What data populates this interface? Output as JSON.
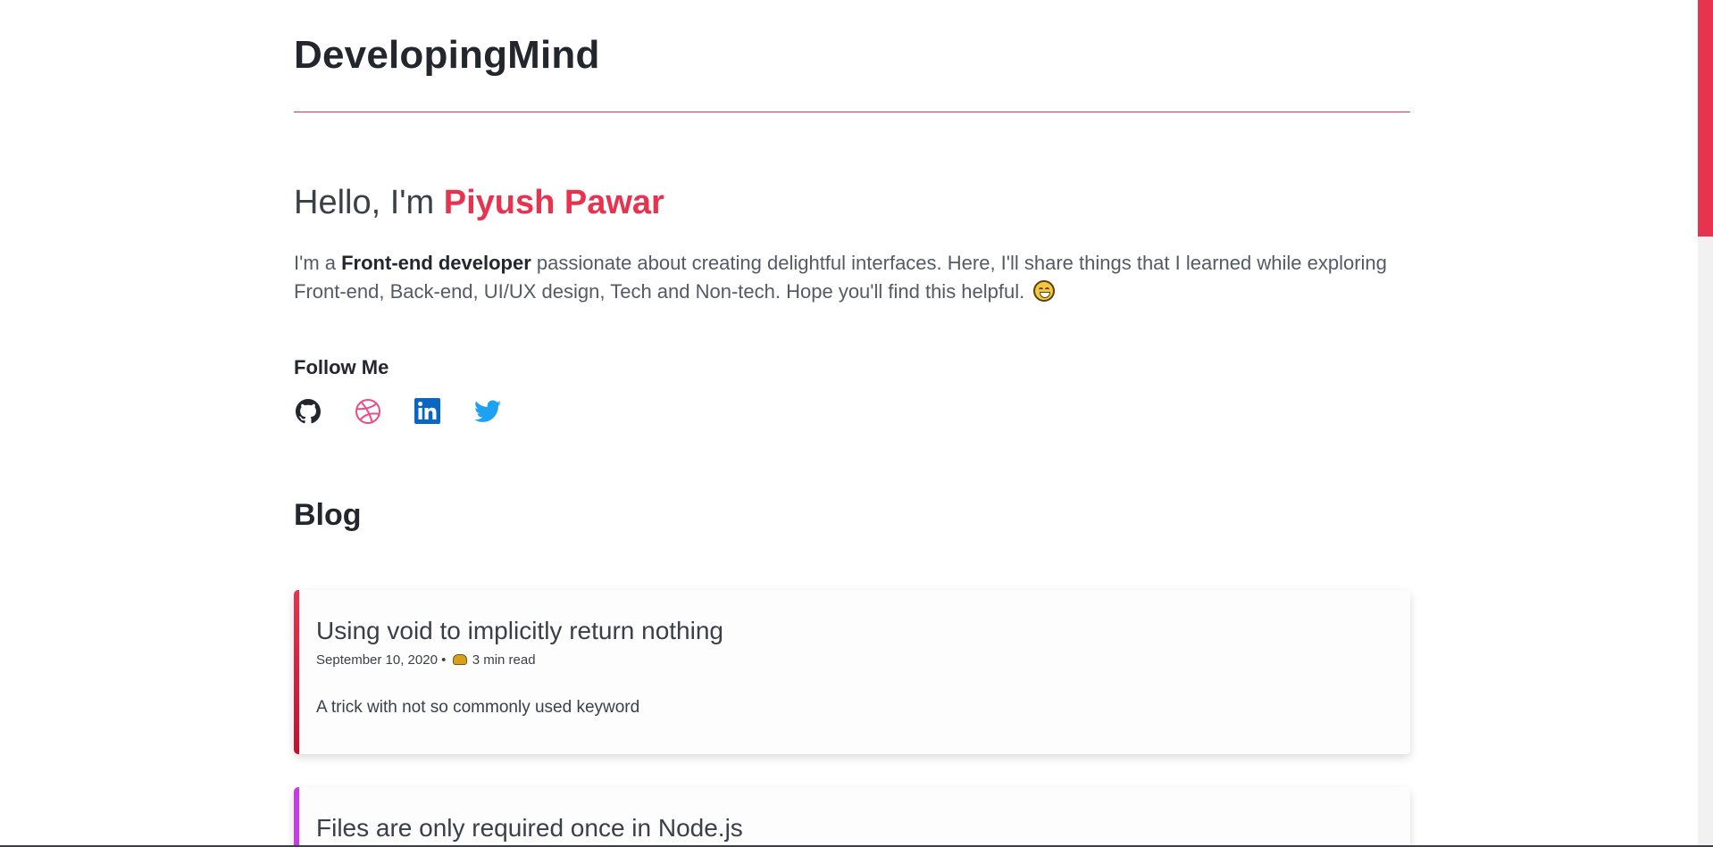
{
  "site": {
    "title": "DevelopingMind"
  },
  "hero": {
    "greeting": "Hello, I'm ",
    "name": "Piyush Pawar",
    "intro_before": "I'm a ",
    "intro_bold": "Front-end developer",
    "intro_after": " passionate about creating delightful interfaces. Here, I'll share things that I learned while exploring Front-end, Back-end, UI/UX design, Tech and Non-tech. Hope you'll find this helpful. "
  },
  "follow": {
    "heading": "Follow Me",
    "links": [
      {
        "icon": "github-icon",
        "color": "#23262d"
      },
      {
        "icon": "dribbble-icon",
        "color": "#ea4c89"
      },
      {
        "icon": "linkedin-icon",
        "color": "#0a66c2"
      },
      {
        "icon": "twitter-icon",
        "color": "#1da1f2"
      }
    ]
  },
  "blog": {
    "heading": "Blog",
    "posts": [
      {
        "title": "Using void to implicitly return nothing",
        "date": "September 10, 2020",
        "read_time": "3 min read",
        "description": "A trick with not so commonly used keyword",
        "accent_color": "#e8334f"
      },
      {
        "title": "Files are only required once in Node.js",
        "accent_color": "#c83ae8"
      }
    ]
  },
  "colors": {
    "accent": "#e8334f",
    "text": "#23262d"
  }
}
